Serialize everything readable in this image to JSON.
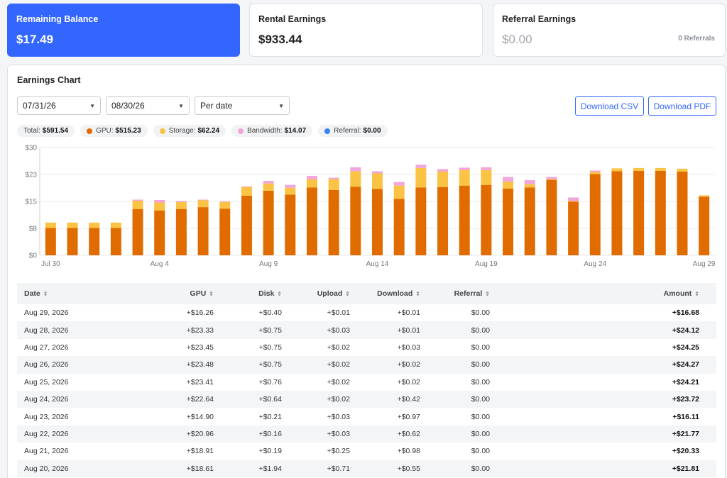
{
  "cards": {
    "remaining": {
      "label": "Remaining Balance",
      "value": "$17.49"
    },
    "rental": {
      "label": "Rental Earnings",
      "value": "$933.44"
    },
    "referral": {
      "label": "Referral Earnings",
      "value": "$0.00",
      "count": "0 Referrals"
    }
  },
  "panel": {
    "title": "Earnings Chart",
    "start_date": "07/31/26",
    "end_date": "08/30/26",
    "granularity": "Per date",
    "download_csv": "Download CSV",
    "download_pdf": "Download PDF"
  },
  "legend": {
    "total_label": "Total:",
    "total_value": "$591.54",
    "gpu_label": "GPU:",
    "gpu_value": "$515.23",
    "storage_label": "Storage:",
    "storage_value": "$62.24",
    "bandwidth_label": "Bandwidth:",
    "bandwidth_value": "$14.07",
    "referral_label": "Referral:",
    "referral_value": "$0.00"
  },
  "colors": {
    "gpu": "#e06c00",
    "storage": "#fbc343",
    "bandwidth": "#f0a6da",
    "referral": "#3b82f6",
    "accent": "#3366ff"
  },
  "chart_data": {
    "type": "bar",
    "stacked": true,
    "ylim": [
      0,
      30
    ],
    "yticks": [
      "$0",
      "$8",
      "$15",
      "$23",
      "$30"
    ],
    "xtick_labels": [
      "Jul 30",
      "Aug 4",
      "Aug 9",
      "Aug 14",
      "Aug 19",
      "Aug 24",
      "Aug 29"
    ],
    "categories": [
      "Jul 30",
      "Jul 31",
      "Aug 1",
      "Aug 2",
      "Aug 3",
      "Aug 4",
      "Aug 5",
      "Aug 6",
      "Aug 7",
      "Aug 8",
      "Aug 9",
      "Aug 10",
      "Aug 11",
      "Aug 12",
      "Aug 13",
      "Aug 14",
      "Aug 15",
      "Aug 16",
      "Aug 17",
      "Aug 18",
      "Aug 19",
      "Aug 20",
      "Aug 21",
      "Aug 22",
      "Aug 23",
      "Aug 24",
      "Aug 25",
      "Aug 26",
      "Aug 27",
      "Aug 28",
      "Aug 29"
    ],
    "series": [
      {
        "name": "GPU",
        "values": [
          7.6,
          7.6,
          7.6,
          7.6,
          12.9,
          12.5,
          12.9,
          13.4,
          13.0,
          16.6,
          18.0,
          16.9,
          18.9,
          18.2,
          19.1,
          18.5,
          15.7,
          18.9,
          19.0,
          19.4,
          19.6,
          18.6,
          18.9,
          21.0,
          14.9,
          22.6,
          23.4,
          23.5,
          23.5,
          23.3,
          16.3
        ]
      },
      {
        "name": "Storage",
        "values": [
          1.5,
          1.5,
          1.5,
          1.5,
          2.3,
          2.2,
          1.9,
          1.9,
          1.8,
          2.4,
          2.0,
          1.9,
          2.2,
          3.0,
          4.3,
          4.3,
          3.7,
          5.4,
          4.3,
          4.3,
          4.1,
          1.9,
          0.9,
          0.2,
          0.2,
          0.6,
          0.8,
          0.8,
          0.8,
          0.8,
          0.4
        ]
      },
      {
        "name": "Bandwidth",
        "values": [
          0.0,
          0.0,
          0.0,
          0.0,
          0.3,
          0.7,
          0.3,
          0.2,
          0.2,
          0.2,
          0.7,
          0.8,
          1.0,
          0.4,
          1.1,
          0.6,
          1.0,
          0.9,
          0.7,
          0.7,
          0.8,
          1.3,
          1.1,
          0.6,
          1.0,
          0.4,
          0.0,
          0.0,
          0.0,
          0.0,
          0.0
        ]
      },
      {
        "name": "Referral",
        "values": [
          0,
          0,
          0,
          0,
          0,
          0,
          0,
          0,
          0,
          0,
          0,
          0,
          0,
          0,
          0,
          0,
          0,
          0,
          0,
          0,
          0,
          0,
          0,
          0,
          0,
          0,
          0,
          0,
          0,
          0,
          0
        ]
      }
    ]
  },
  "table": {
    "headers": [
      "Date",
      "GPU",
      "Disk",
      "Upload",
      "Download",
      "Referral",
      "Amount"
    ],
    "rows": [
      [
        "Aug 29, 2026",
        "+$16.26",
        "+$0.40",
        "+$0.01",
        "+$0.01",
        "$0.00",
        "+$16.68"
      ],
      [
        "Aug 28, 2026",
        "+$23.33",
        "+$0.75",
        "+$0.03",
        "+$0.01",
        "$0.00",
        "+$24.12"
      ],
      [
        "Aug 27, 2026",
        "+$23.45",
        "+$0.75",
        "+$0.02",
        "+$0.03",
        "$0.00",
        "+$24.25"
      ],
      [
        "Aug 26, 2026",
        "+$23.48",
        "+$0.75",
        "+$0.02",
        "+$0.02",
        "$0.00",
        "+$24.27"
      ],
      [
        "Aug 25, 2026",
        "+$23.41",
        "+$0.76",
        "+$0.02",
        "+$0.02",
        "$0.00",
        "+$24.21"
      ],
      [
        "Aug 24, 2026",
        "+$22.64",
        "+$0.64",
        "+$0.02",
        "+$0.42",
        "$0.00",
        "+$23.72"
      ],
      [
        "Aug 23, 2026",
        "+$14.90",
        "+$0.21",
        "+$0.03",
        "+$0.97",
        "$0.00",
        "+$16.11"
      ],
      [
        "Aug 22, 2026",
        "+$20.96",
        "+$0.16",
        "+$0.03",
        "+$0.62",
        "$0.00",
        "+$21.77"
      ],
      [
        "Aug 21, 2026",
        "+$18.91",
        "+$0.19",
        "+$0.25",
        "+$0.98",
        "$0.00",
        "+$20.33"
      ],
      [
        "Aug 20, 2026",
        "+$18.61",
        "+$1.94",
        "+$0.71",
        "+$0.55",
        "$0.00",
        "+$21.81"
      ]
    ]
  }
}
